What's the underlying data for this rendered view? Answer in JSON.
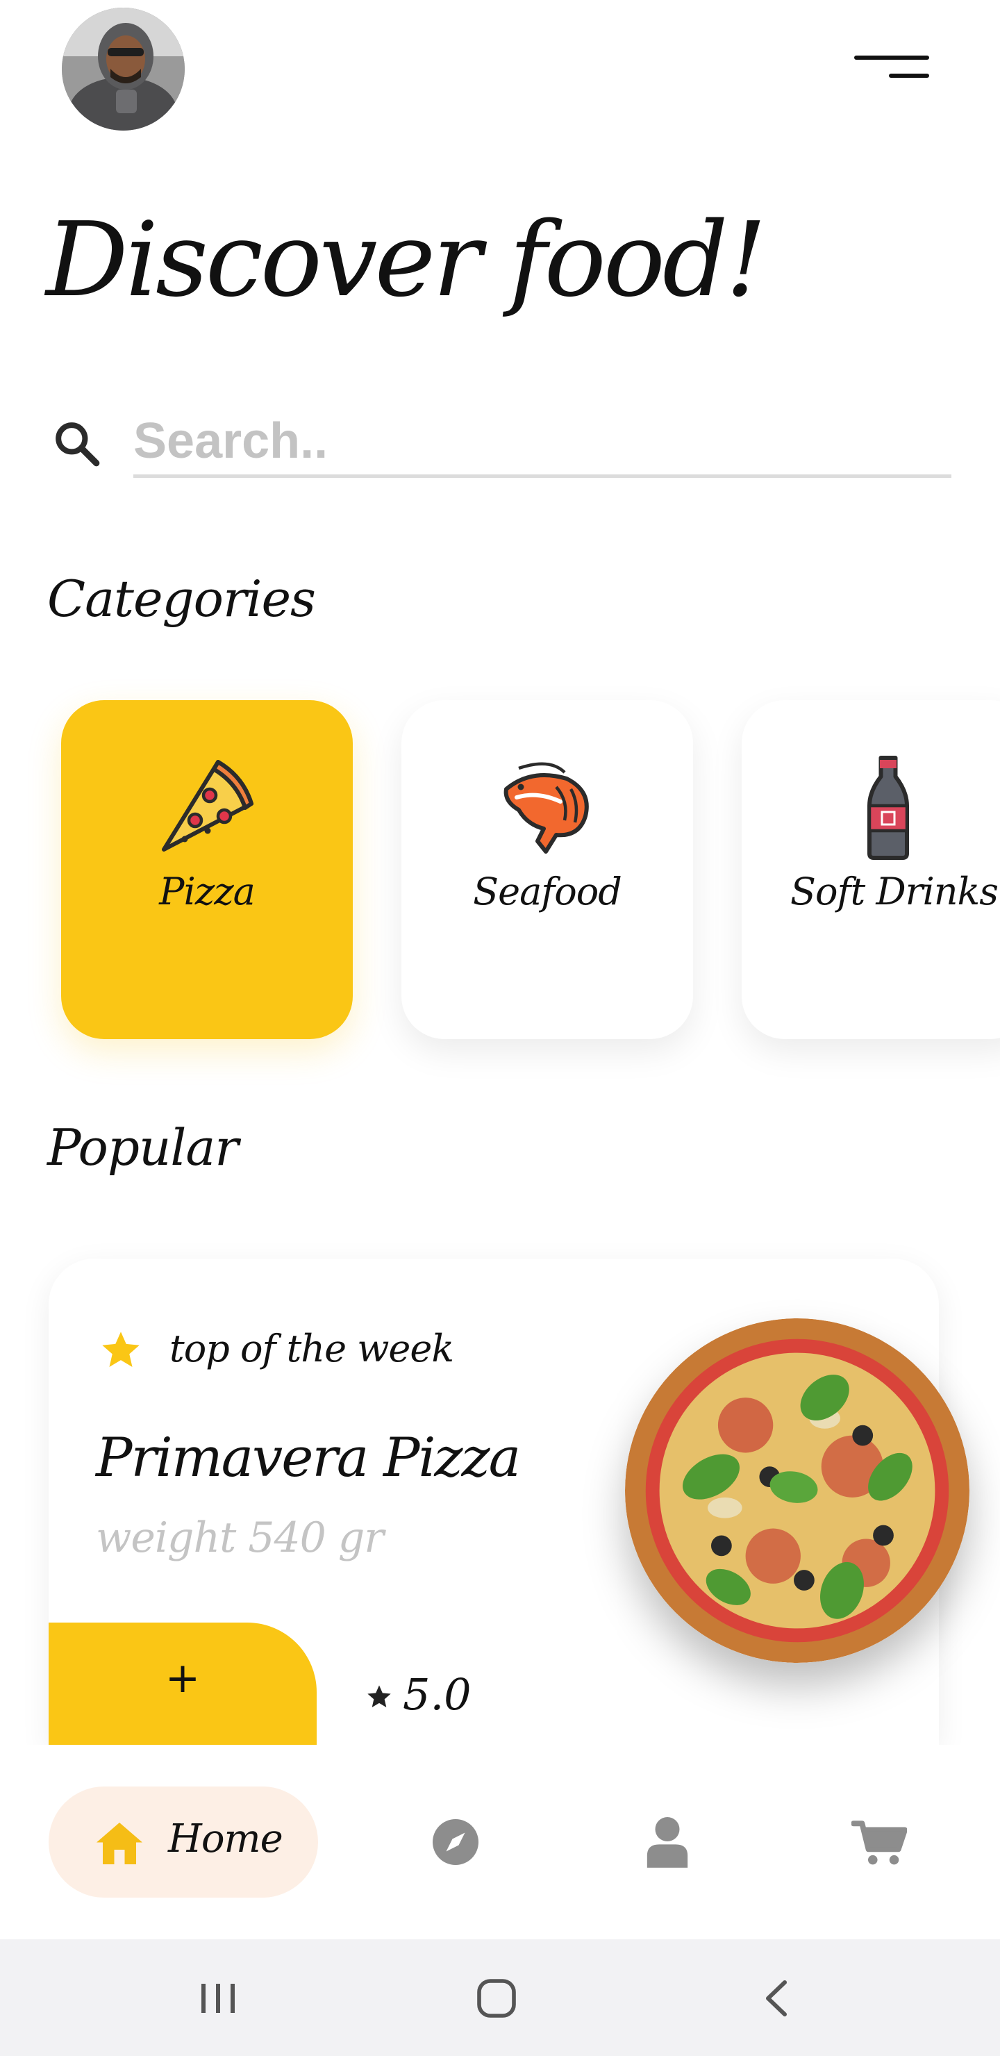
{
  "header": {
    "avatar_icon": "user-photo-avatar",
    "menu_icon": "hamburger-menu-icon"
  },
  "title": "Discover food!",
  "search": {
    "placeholder": "Search..",
    "value": ""
  },
  "categories": {
    "title": "Categories",
    "items": [
      {
        "label": "Pizza",
        "icon": "pizza-slice-icon",
        "selected": true
      },
      {
        "label": "Seafood",
        "icon": "shrimp-icon",
        "selected": false
      },
      {
        "label": "Soft Drinks",
        "icon": "soda-bottle-icon",
        "selected": false
      }
    ]
  },
  "popular": {
    "title": "Popular",
    "card": {
      "badge": "top of the week",
      "name": "Primavera Pizza",
      "weight": "weight 540 gr",
      "add_label": "+",
      "rating": "5.0"
    }
  },
  "bottom_nav": {
    "items": [
      {
        "label": "Home",
        "icon": "home-icon",
        "active": true
      },
      {
        "icon": "compass-icon"
      },
      {
        "icon": "user-icon"
      },
      {
        "icon": "cart-icon"
      }
    ]
  },
  "system_nav": {
    "recents_icon": "recents-icon",
    "home_icon": "system-home-icon",
    "back_icon": "back-icon"
  },
  "colors": {
    "accent": "#fac615",
    "nav_active_bg": "#fdefe5",
    "icon_gray": "#8d8d8d"
  }
}
